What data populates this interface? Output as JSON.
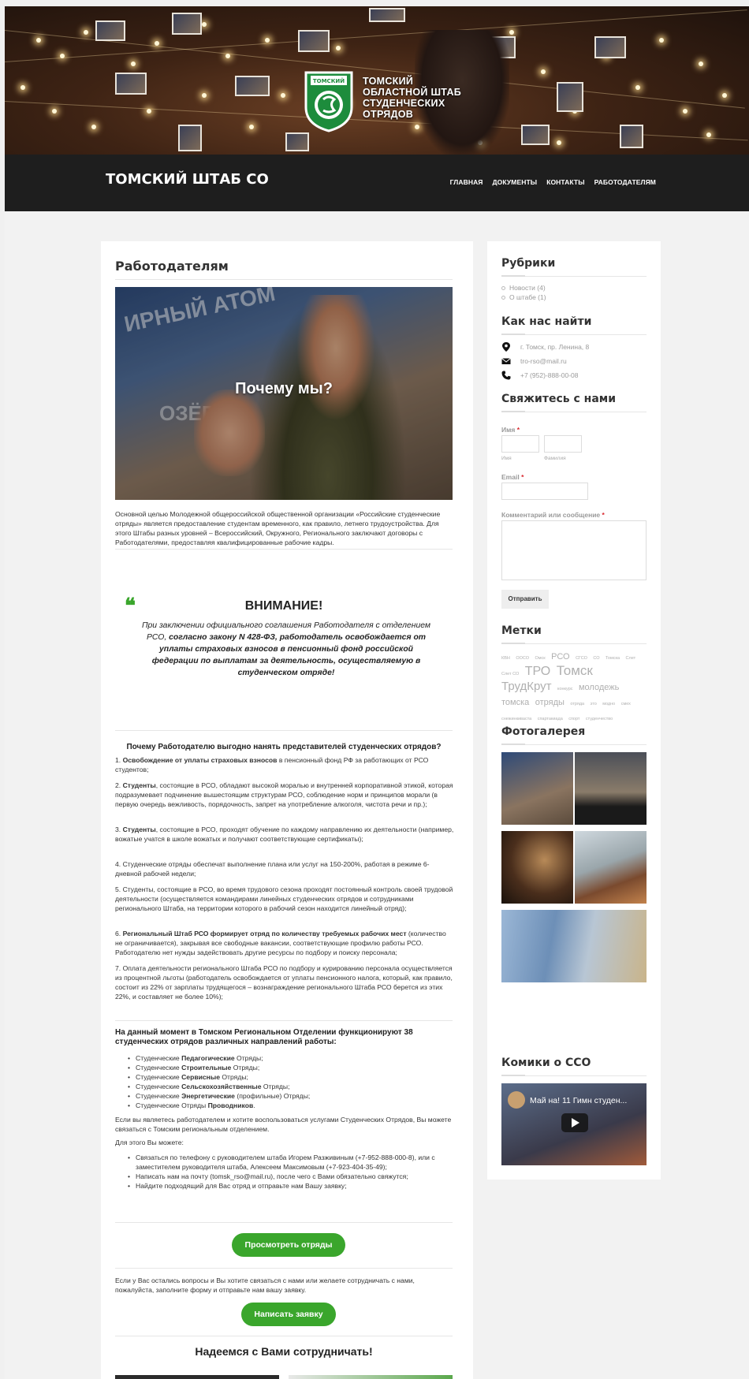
{
  "banner": {
    "logo_lines": [
      "ТОМСКИЙ",
      "ОБЛАСТНОЙ ШТАБ",
      "СТУДЕНЧЕСКИХ",
      "ОТРЯДОВ"
    ]
  },
  "header": {
    "site_title": "ТОМСКИЙ ШТАБ СО",
    "menu": [
      "ГЛАВНАЯ",
      "ДОКУМЕНТЫ",
      "КОНТАКТЫ",
      "РАБОТОДАТЕЛЯМ"
    ]
  },
  "main": {
    "title": "Работодателям",
    "hero_caption": "Почему мы?",
    "hero_sign_1": "ИРНЫЙ АТОМ",
    "hero_sign_2": "ОЗЁР",
    "intro": "Основной целью Молодежной общероссийской общественной организации «Российские студенческие отряды» является предоставление студентам временного, как правило, летнего трудоустройства. Для этого Штабы разных уровней – Всероссийский, Окружного, Регионального заключают договоры с Работодателями, предоставляя квалифицированные рабочие кадры.",
    "attention_title": "ВНИМАНИЕ!",
    "attention_text_1": "При заключении официального соглашения Работодателя с отделением РСО, ",
    "attention_text_2": "согласно закону N 428-ФЗ, работодатель освобождается от уплаты страховых взносов в пенсионный фонд российской федерации по выплатам за деятельность, осуществляемую в студенческом отряде!",
    "why_title": "Почему Работодателю выгодно нанять представителей студенческих отрядов?",
    "reasons": [
      {
        "pre": "1. ",
        "b": "Освобождение от уплаты страховых взносов",
        "post": " в пенсионный фонд РФ за работающих от РСО студентов;"
      },
      {
        "pre": "2. ",
        "b": "Студенты",
        "post": ", состоящие в РСО, обладают высокой моралью и внутренней корпоративной этикой, которая подразумевает подчинение вышестоящим структурам РСО, соблюдение норм и принципов морали (в первую очередь вежливость, порядочность, запрет на употребление алкоголя, чистота речи и пр.);"
      },
      {
        "pre": "3. ",
        "b": "Студенты",
        "post": ", состоящие в РСО, проходят обучение по каждому направлению их деятельности (например, вожатые учатся в школе вожатых и получают соответствующие сертификаты);"
      },
      {
        "pre": "4. ",
        "b": "",
        "post": "Студенческие отряды обеспечат выполнение плана или услуг на 150-200%, работая в режиме 6-дневной рабочей недели;"
      },
      {
        "pre": "5. ",
        "b": "",
        "post": "Студенты, состоящие в РСО, во время трудового сезона проходят постоянный контроль своей трудовой деятельности (осуществляется командирами линейных студенческих отрядов и сотрудниками регионального Штаба, на территории которого в рабочий сезон находится линейный отряд);"
      },
      {
        "pre": "6. ",
        "b": "Региональный Штаб РСО формирует отряд по количеству требуемых рабочих мест",
        "post": " (количество не ограничивается), закрывая все свободные вакансии, соответствующие профилю работы РСО. Работодателю нет нужды задействовать другие ресурсы по подбору и поиску персонала;"
      },
      {
        "pre": "7. ",
        "b": "",
        "post": "Оплата деятельности регионального Штаба РСО по подбору и курированию персонала осуществляется из процентной льготы (работодатель освобождается от уплаты пенсионного налога, который, как правило, состоит из 22% от зарплаты трудящегося – вознаграждение регионального Штаба РСО берется из этих 22%, и составляет не более 10%);"
      }
    ],
    "squads_title": "На данный момент в Томском Региональном Отделении функционируют 38 студенческих отрядов различных направлений работы:",
    "squads": [
      {
        "pre": "Студенческие ",
        "b": "Педагогические",
        "post": " Отряды;"
      },
      {
        "pre": "Студенческие ",
        "b": "Строительные",
        "post": " Отряды;"
      },
      {
        "pre": "Студенческие ",
        "b": "Сервисные",
        "post": " Отряды;"
      },
      {
        "pre": "Студенческие ",
        "b": "Сельскохозяйственные",
        "post": " Отряды;"
      },
      {
        "pre": "Студенческие ",
        "b": "Энергетические",
        "post": " (профильные) Отряды;"
      },
      {
        "pre": "Студенческие Отряды ",
        "b": "Проводников",
        "post": "."
      }
    ],
    "if_employer": "Если вы являетесь работодателем и хотите воспользоваться услугами Студенческих Отрядов, Вы можете связаться с Томским региональным отделением.",
    "for_this": "Для этого Вы можете:",
    "ways": [
      "Связаться по телефону с руководителем штаба Игорем Разживиным (+7-952-888-000-8), или с заместителем руководителя штаба, Алексеем Максимовым (+7-923-404-35-49);",
      "Написать нам на почту (tomsk_rso@mail.ru), после чего с Вами обязательно свяжутся;",
      "Найдите подходящий для Вас отряд и отправьте нам Вашу заявку;"
    ],
    "btn_view": "Просмотреть отряды",
    "questions": "Если у Вас остались вопросы и Вы хотите связаться с нами или желаете сотрудничать с нами, пожалуйста, заполните форму и отправьте нам вашу заявку.",
    "btn_apply": "Написать заявку",
    "hope": "Надеемся с Вами сотрудничать!"
  },
  "sidebar": {
    "rubrics_title": "Рубрики",
    "rubrics": [
      "Новости (4)",
      "О штабе (1)"
    ],
    "find_title": "Как нас найти",
    "address": "г. Томск, пр. Ленина, 8",
    "email": "tro-rso@mail.ru",
    "phone": "+7 (952)-888-00-08",
    "contact_title": "Свяжитесь с нами",
    "name_label": "Имя",
    "first_name": "Имя",
    "last_name": "Фамилия",
    "email_label": "Email",
    "comment_label": "Комментарий или сообщение",
    "required_mark": "*",
    "submit": "Отправить",
    "tags_title": "Метки",
    "tags": [
      {
        "t": "КВН",
        "s": 5.5
      },
      {
        "t": "ООСО",
        "s": 5.5
      },
      {
        "t": "Омск",
        "s": 5.5
      },
      {
        "t": "РСО",
        "s": 11
      },
      {
        "t": "СГСО",
        "s": 5.5
      },
      {
        "t": "СО",
        "s": 5.5
      },
      {
        "t": "Томска",
        "s": 5.5
      },
      {
        "t": "Слет",
        "s": 5.5
      },
      {
        "t": "Слет СО",
        "s": 5.5
      },
      {
        "t": "ТРО",
        "s": 16
      },
      {
        "t": "Томск",
        "s": 17
      },
      {
        "t": "ТрудКрут",
        "s": 15
      },
      {
        "t": "конкурс",
        "s": 5.5
      },
      {
        "t": "молодежь",
        "s": 11
      },
      {
        "t": "томска",
        "s": 11
      },
      {
        "t": "отряды",
        "s": 11
      },
      {
        "t": "отряда",
        "s": 5.5
      },
      {
        "t": "это",
        "s": 5.5
      },
      {
        "t": "модно",
        "s": 5.5
      },
      {
        "t": "смех",
        "s": 5.5
      },
      {
        "t": "снежинкиваста",
        "s": 5.5
      },
      {
        "t": "спартакиада",
        "s": 5.5
      },
      {
        "t": "спорт",
        "s": 5.5
      },
      {
        "t": "студенчество",
        "s": 5.5
      }
    ],
    "gallery_title": "Фотогалерея",
    "comics_title": "Комики о ССО",
    "video_title": "Май на! 11 Гимн студен..."
  },
  "colors": {
    "accent_green": "#3aa62c",
    "nav_bg": "#1e1e1e",
    "required_red": "#d9262c"
  },
  "icons": {
    "address": "map-pin-icon",
    "email": "envelope-icon",
    "phone": "phone-icon",
    "quote": "quote-icon",
    "play": "play-icon"
  }
}
